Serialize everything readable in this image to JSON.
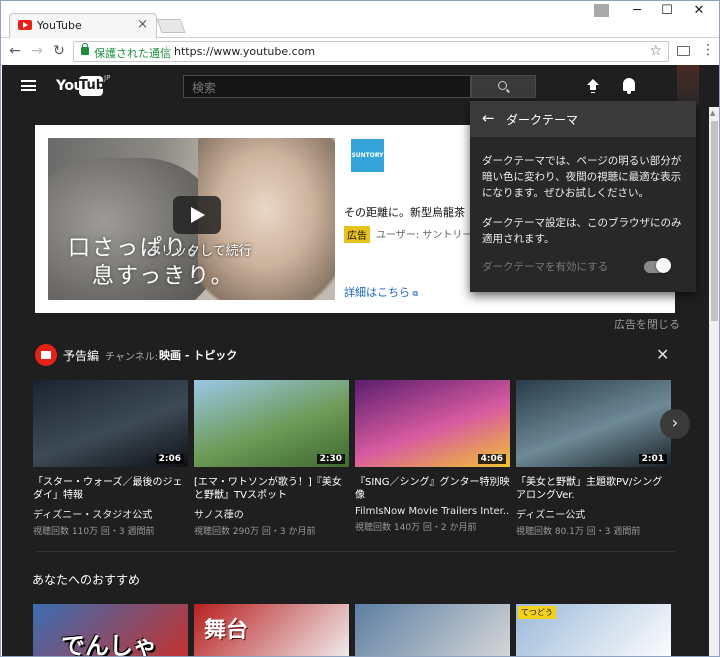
{
  "browser": {
    "tab_title": "YouTube",
    "tab_close": "×",
    "window_minimize": "─",
    "window_maximize": "☐",
    "window_close": "✕",
    "secure_label": "保護された通信",
    "url": "https://www.youtube.com",
    "bookmark_icon": "☆",
    "menu_icon": "⋮",
    "nav": {
      "back": "←",
      "forward": "→",
      "reload": "↻"
    }
  },
  "header": {
    "logo_you": "You",
    "logo_tube": "Tube",
    "logo_region": "JP",
    "search_placeholder": "検索"
  },
  "ad": {
    "brand": "SUNTORY",
    "copy_line1": "口さっぱり。",
    "copy_line2": "息すっきり。",
    "click_label": "クリックして続行",
    "title": "その距離に。新型烏龍茶",
    "badge": "広告",
    "user": "ユーザー: サントリー公",
    "more_link": "詳細はこちら",
    "close_ad": "広告を閉じる"
  },
  "shelf": {
    "title": "予告編",
    "channel_label": "チャンネル:",
    "channel_name": "映画 - トピック",
    "close": "✕",
    "next": "›",
    "videos": [
      {
        "title": "「スター・ウォーズ／最後のジェダイ」特報",
        "channel": "ディズニー・スタジオ公式",
        "meta": "視聴回数 110万 回・3 週間前",
        "duration": "2:06",
        "colors": [
          "#1a2430",
          "#3d4a56",
          "#0e1116"
        ]
      },
      {
        "title": "[エマ・ワトソンが歌う！]『美女と野獣』TVスポット",
        "channel": "サノス葎の",
        "meta": "視聴回数 290万 回・3 か月前",
        "duration": "2:30",
        "colors": [
          "#9bc7e6",
          "#6d9b58",
          "#3e6a30"
        ]
      },
      {
        "title": "『SING／シング』グンター特別映像",
        "channel": "FilmIsNow Movie Trailers Inter...",
        "meta": "視聴回数 140万 回・2 か月前",
        "duration": "4:06",
        "colors": [
          "#5b1e6e",
          "#d85ba0",
          "#f1c232"
        ]
      },
      {
        "title": "「美女と野獣」主題歌PV/シングアロングVer.",
        "channel": "ディズニー公式",
        "meta": "視聴回数 80.1万 回・3 週間前",
        "duration": "2:01",
        "colors": [
          "#2a3b48",
          "#6d8a96",
          "#1b2228"
        ]
      }
    ]
  },
  "recommended": {
    "title": "あなたへのおすすめ",
    "thumb_texts": [
      "でんしゃ",
      "舞台",
      "",
      "てつどう"
    ],
    "colors": [
      [
        "#3b6db3",
        "#c8312b"
      ],
      [
        "#b82020",
        "#f2f2f2"
      ],
      [
        "#5c7fa3",
        "#d9d9d9"
      ],
      [
        "#9bb9d9",
        "#ffffff"
      ]
    ]
  },
  "dark_theme_popup": {
    "title": "ダークテーマ",
    "description1": "ダークテーマでは、ページの明るい部分が暗い色に変わり、夜間の視聴に最適な表示になります。ぜひお試しください。",
    "description2": "ダークテーマ設定は、このブラウザにのみ適用されます。",
    "toggle_label": "ダークテーマを有効にする"
  }
}
